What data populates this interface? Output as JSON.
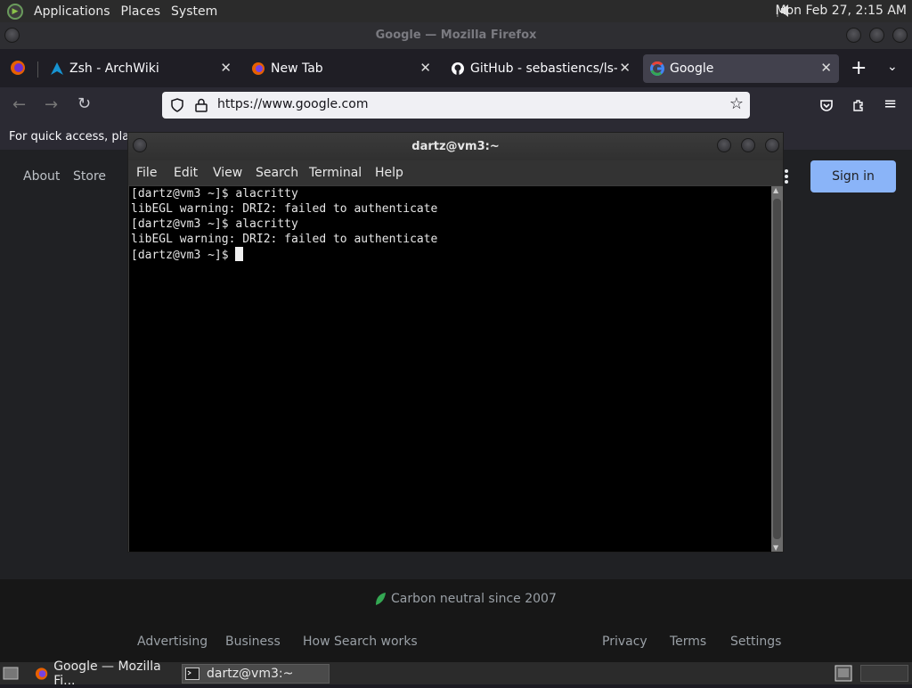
{
  "top_panel": {
    "menus": [
      "Applications",
      "Places",
      "System"
    ],
    "clock": "Mon Feb 27,  2:15 AM"
  },
  "firefox": {
    "window_title": "Google — Mozilla Firefox",
    "tabs": [
      {
        "label": "Zsh - ArchWiki",
        "icon": "archwiki-icon"
      },
      {
        "label": "New Tab",
        "icon": "firefox-icon"
      },
      {
        "label": "GitHub - sebastiencs/ls-icons",
        "icon": "github-icon"
      },
      {
        "label": "Google",
        "icon": "google-icon",
        "active": true
      }
    ],
    "url": "https://www.google.com",
    "bookmarks_hint": "For quick access, place"
  },
  "google": {
    "header_links": [
      "About",
      "Store"
    ],
    "sign_in": "Sign in",
    "carbon": "Carbon neutral since 2007",
    "footer_left": [
      "Advertising",
      "Business",
      "How Search works"
    ],
    "footer_right": [
      "Privacy",
      "Terms",
      "Settings"
    ]
  },
  "terminal": {
    "title": "dartz@vm3:~",
    "menu": [
      "File",
      "Edit",
      "View",
      "Search",
      "Terminal",
      "Help"
    ],
    "lines": [
      "[dartz@vm3 ~]$ alacritty",
      "libEGL warning: DRI2: failed to authenticate",
      "[dartz@vm3 ~]$ alacritty",
      "libEGL warning: DRI2: failed to authenticate",
      "[dartz@vm3 ~]$ "
    ]
  },
  "taskbar": {
    "items": [
      "Google — Mozilla Fi...",
      "dartz@vm3:~"
    ]
  },
  "colors": {
    "signin_bg": "#8ab4f8",
    "terminal_bg": "#000000",
    "active_tab": "#42414d"
  }
}
